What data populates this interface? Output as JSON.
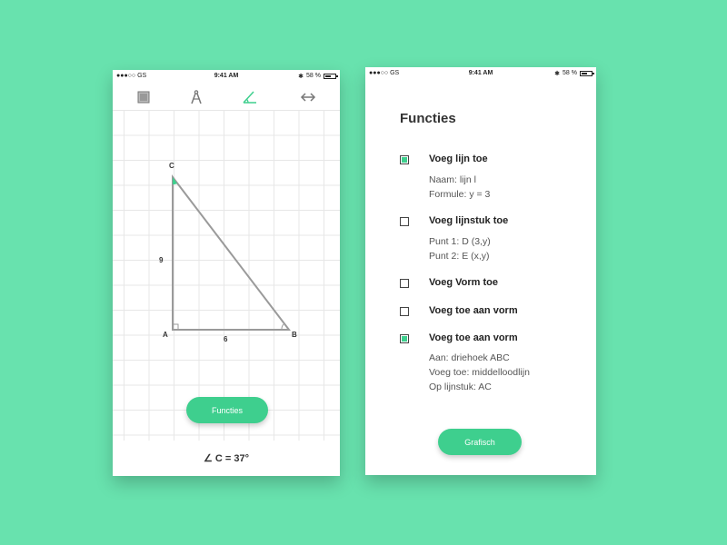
{
  "left_phone": {
    "status": {
      "carrier": "●●●○○ GS",
      "time": "9:41 AM",
      "battery": "58 %"
    },
    "toolbar": {
      "tools": [
        "layers-icon",
        "compass-icon",
        "angle-icon",
        "arrows-horizontal-icon"
      ],
      "active_tool": "angle-icon",
      "accent": "#3ecf8e"
    },
    "triangle": {
      "labels": {
        "a": "A",
        "b": "B",
        "c": "C"
      },
      "sides": {
        "ac": "9",
        "ab": "6"
      }
    },
    "functies_button": "Functies",
    "angle_readout": "∠ C = 37°"
  },
  "right_phone": {
    "status": {
      "carrier": "●●●○○ GS",
      "time": "9:41 AM",
      "battery": "58 %"
    },
    "title": "Functies",
    "items": [
      {
        "label": "Voeg lijn toe",
        "checked": true,
        "details": [
          "Naam:   lijn l",
          "Formule:   y = 3"
        ]
      },
      {
        "label": "Voeg lijnstuk toe",
        "checked": false,
        "details": [
          "Punt 1:   D  (3,y)",
          "Punt 2:   E  (x,y)"
        ]
      },
      {
        "label": "Voeg Vorm toe",
        "checked": false,
        "details": []
      },
      {
        "label": "Voeg toe aan vorm",
        "checked": false,
        "details": []
      },
      {
        "label": "Voeg toe aan vorm",
        "checked": true,
        "details": [
          "Aan: driehoek ABC",
          "Voeg toe: middelloodlijn",
          "Op lijnstuk: AC"
        ]
      }
    ],
    "grafisch_button": "Grafisch"
  },
  "colors": {
    "background": "#68e2ae",
    "accent": "#3ecf8e"
  }
}
